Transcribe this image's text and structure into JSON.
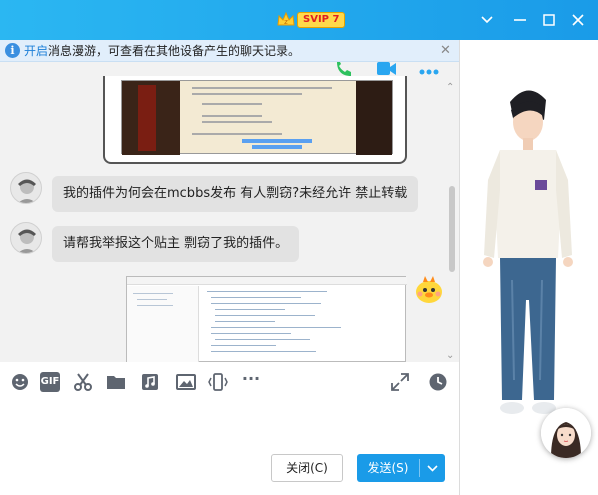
{
  "window": {
    "vip_badge": "SVIP 7",
    "controls": [
      "chevron-down-icon",
      "minimize-icon",
      "maximize-icon",
      "close-icon"
    ],
    "accent": "#1a9be8"
  },
  "notice": {
    "link": "开启",
    "text": "消息漫游，可查看在其他设备产生的聊天记录。",
    "close": "✕"
  },
  "chat": {
    "messages": [
      {
        "type": "image",
        "from": "self",
        "icon": "screenshot-minecraft"
      },
      {
        "type": "text",
        "from": "other",
        "text": "我的插件为何会在mcbbs发布 有人剽窃?未经允许 禁止转载"
      },
      {
        "type": "text",
        "from": "other",
        "text": "请帮我举报这个贴主 剽窃了我的插件。"
      },
      {
        "type": "image",
        "from": "self",
        "icon": "screenshot-code-editor"
      }
    ]
  },
  "toolbar": {
    "left_tools": [
      "emoji-icon",
      "gif-icon",
      "scissors-icon",
      "folder-icon",
      "music-icon",
      "image-icon",
      "shake-icon",
      "more-icon"
    ],
    "gif_label": "GIF",
    "more_label": "···",
    "right_tools": [
      "expand-icon",
      "history-icon"
    ]
  },
  "buttons": {
    "close_label": "关闭(C)",
    "send_label": "发送(S)"
  }
}
